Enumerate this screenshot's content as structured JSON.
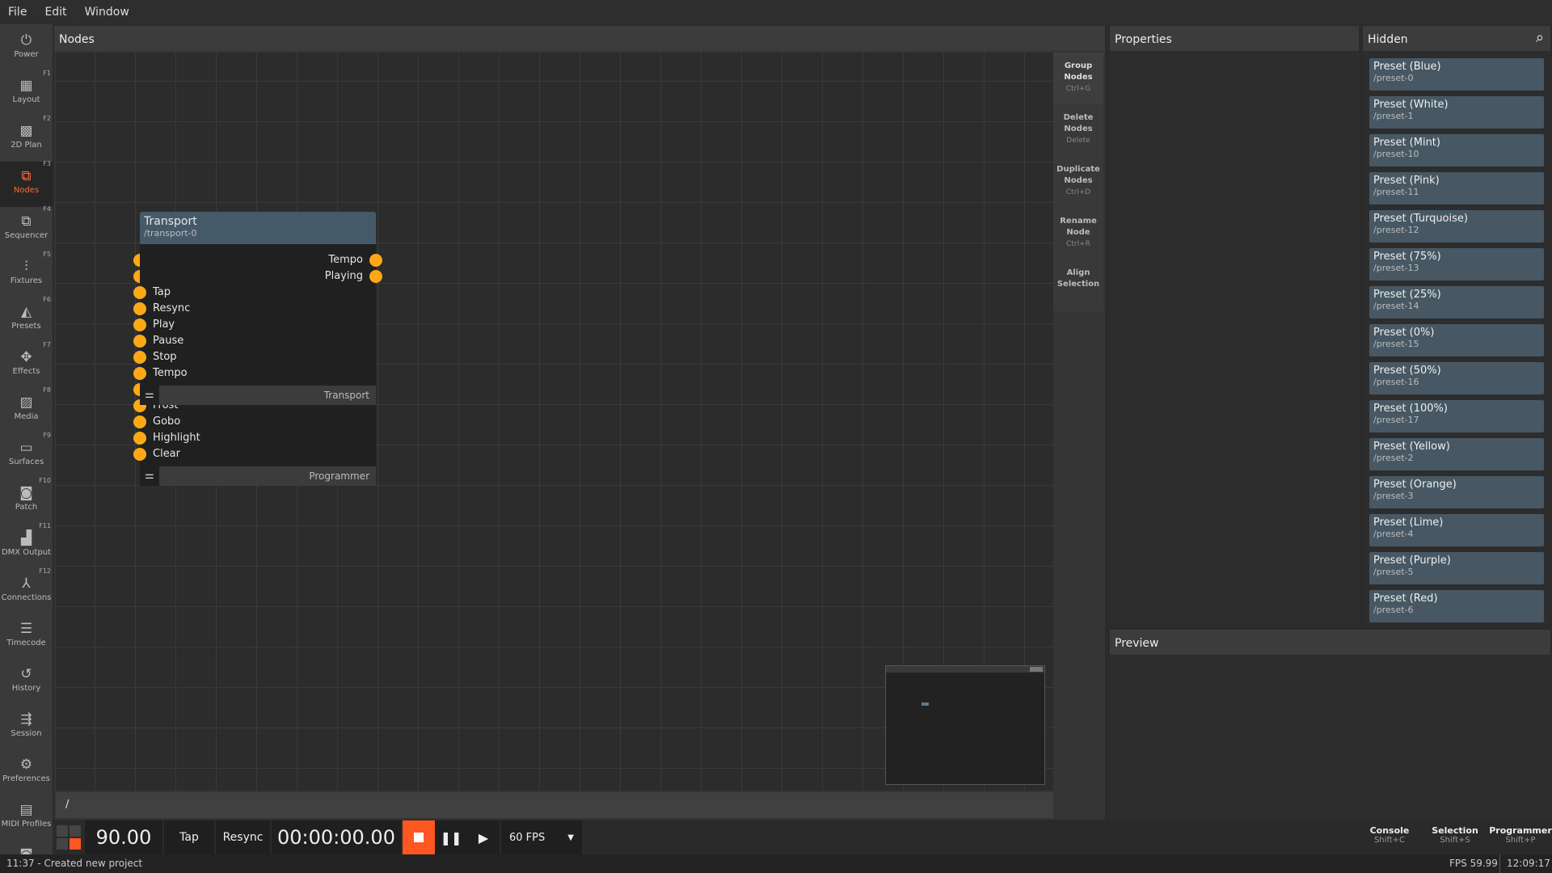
{
  "menu": [
    "File",
    "Edit",
    "Window"
  ],
  "sidebar": [
    {
      "label": "Power",
      "icon": "power-icon",
      "glyph": "⏻",
      "key": ""
    },
    {
      "label": "Layout",
      "icon": "layout-icon",
      "glyph": "▦",
      "key": "F1"
    },
    {
      "label": "2D Plan",
      "icon": "grid-icon",
      "glyph": "▩",
      "key": "F2"
    },
    {
      "label": "Nodes",
      "icon": "nodes-icon",
      "glyph": "⧉",
      "key": "F3",
      "active": true
    },
    {
      "label": "Sequencer",
      "icon": "sequencer-icon",
      "glyph": "⧉",
      "key": "F4"
    },
    {
      "label": "Fixtures",
      "icon": "sliders-icon",
      "glyph": "⫶",
      "key": "F5"
    },
    {
      "label": "Presets",
      "icon": "presets-icon",
      "glyph": "◭",
      "key": "F6"
    },
    {
      "label": "Effects",
      "icon": "effects-icon",
      "glyph": "✥",
      "key": "F7"
    },
    {
      "label": "Media",
      "icon": "media-icon",
      "glyph": "▨",
      "key": "F8"
    },
    {
      "label": "Surfaces",
      "icon": "monitor-icon",
      "glyph": "▭",
      "key": "F9"
    },
    {
      "label": "Patch",
      "icon": "patch-icon",
      "glyph": "◙",
      "key": "F10"
    },
    {
      "label": "DMX Output",
      "icon": "bar-chart-icon",
      "glyph": "▟",
      "key": "F11"
    },
    {
      "label": "Connections",
      "icon": "connections-icon",
      "glyph": "⅄",
      "key": "F12"
    },
    {
      "label": "Timecode",
      "icon": "timecode-icon",
      "glyph": "☰",
      "key": ""
    },
    {
      "label": "History",
      "icon": "history-icon",
      "glyph": "↺",
      "key": ""
    },
    {
      "label": "Session",
      "icon": "session-icon",
      "glyph": "⇶",
      "key": ""
    },
    {
      "label": "Preferences",
      "icon": "gear-icon",
      "glyph": "⚙",
      "key": ""
    },
    {
      "label": "MIDI Profiles",
      "icon": "midi-icon",
      "glyph": "▤",
      "key": ""
    },
    {
      "label": "",
      "icon": "camera-icon",
      "glyph": "◙",
      "key": ""
    }
  ],
  "nodes_panel": {
    "title": "Nodes",
    "path": "/",
    "tools": [
      {
        "label": "Group Nodes",
        "shortcut": "Ctrl+G"
      },
      {
        "label": "Delete Nodes",
        "shortcut": "Delete"
      },
      {
        "label": "Duplicate Nodes",
        "shortcut": "Ctrl+D"
      },
      {
        "label": "Rename Node",
        "shortcut": "Ctrl+R"
      },
      {
        "label": "Align Selection",
        "shortcut": ""
      }
    ]
  },
  "transport_node": {
    "title": "Transport",
    "path": "/transport-0",
    "outputs": [
      "Tempo",
      "Playing"
    ],
    "inputs": [
      "Tap",
      "Resync",
      "Play",
      "Pause",
      "Stop",
      "Tempo"
    ],
    "footer": "Transport"
  },
  "programmer_node": {
    "inputs": [
      "Frost",
      "Gobo",
      "Highlight",
      "Clear"
    ],
    "footer": "Programmer"
  },
  "properties": {
    "title": "Properties"
  },
  "hidden": {
    "title": "Hidden",
    "items": [
      {
        "name": "Preset (Blue)",
        "path": "/preset-0"
      },
      {
        "name": "Preset (White)",
        "path": "/preset-1"
      },
      {
        "name": "Preset (Mint)",
        "path": "/preset-10"
      },
      {
        "name": "Preset (Pink)",
        "path": "/preset-11"
      },
      {
        "name": "Preset (Turquoise)",
        "path": "/preset-12"
      },
      {
        "name": "Preset (75%)",
        "path": "/preset-13"
      },
      {
        "name": "Preset (25%)",
        "path": "/preset-14"
      },
      {
        "name": "Preset (0%)",
        "path": "/preset-15"
      },
      {
        "name": "Preset (50%)",
        "path": "/preset-16"
      },
      {
        "name": "Preset (100%)",
        "path": "/preset-17"
      },
      {
        "name": "Preset (Yellow)",
        "path": "/preset-2"
      },
      {
        "name": "Preset (Orange)",
        "path": "/preset-3"
      },
      {
        "name": "Preset (Lime)",
        "path": "/preset-4"
      },
      {
        "name": "Preset (Purple)",
        "path": "/preset-5"
      },
      {
        "name": "Preset (Red)",
        "path": "/preset-6"
      }
    ]
  },
  "preview": {
    "title": "Preview"
  },
  "transport_bar": {
    "bpm": "90.00",
    "tap": "Tap",
    "resync": "Resync",
    "time": "00:00:00.00",
    "fps": "60 FPS"
  },
  "right_buttons": [
    {
      "label": "Console",
      "shortcut": "Shift+C"
    },
    {
      "label": "Selection",
      "shortcut": "Shift+S"
    },
    {
      "label": "Programmer",
      "shortcut": "Shift+P"
    }
  ],
  "status": {
    "message": "11:37 - Created new project",
    "fps": "FPS 59.99",
    "clock": "12:09:17"
  },
  "colors": {
    "accent": "#ff5722",
    "port": "#ffa816",
    "node_header": "#455a68"
  }
}
